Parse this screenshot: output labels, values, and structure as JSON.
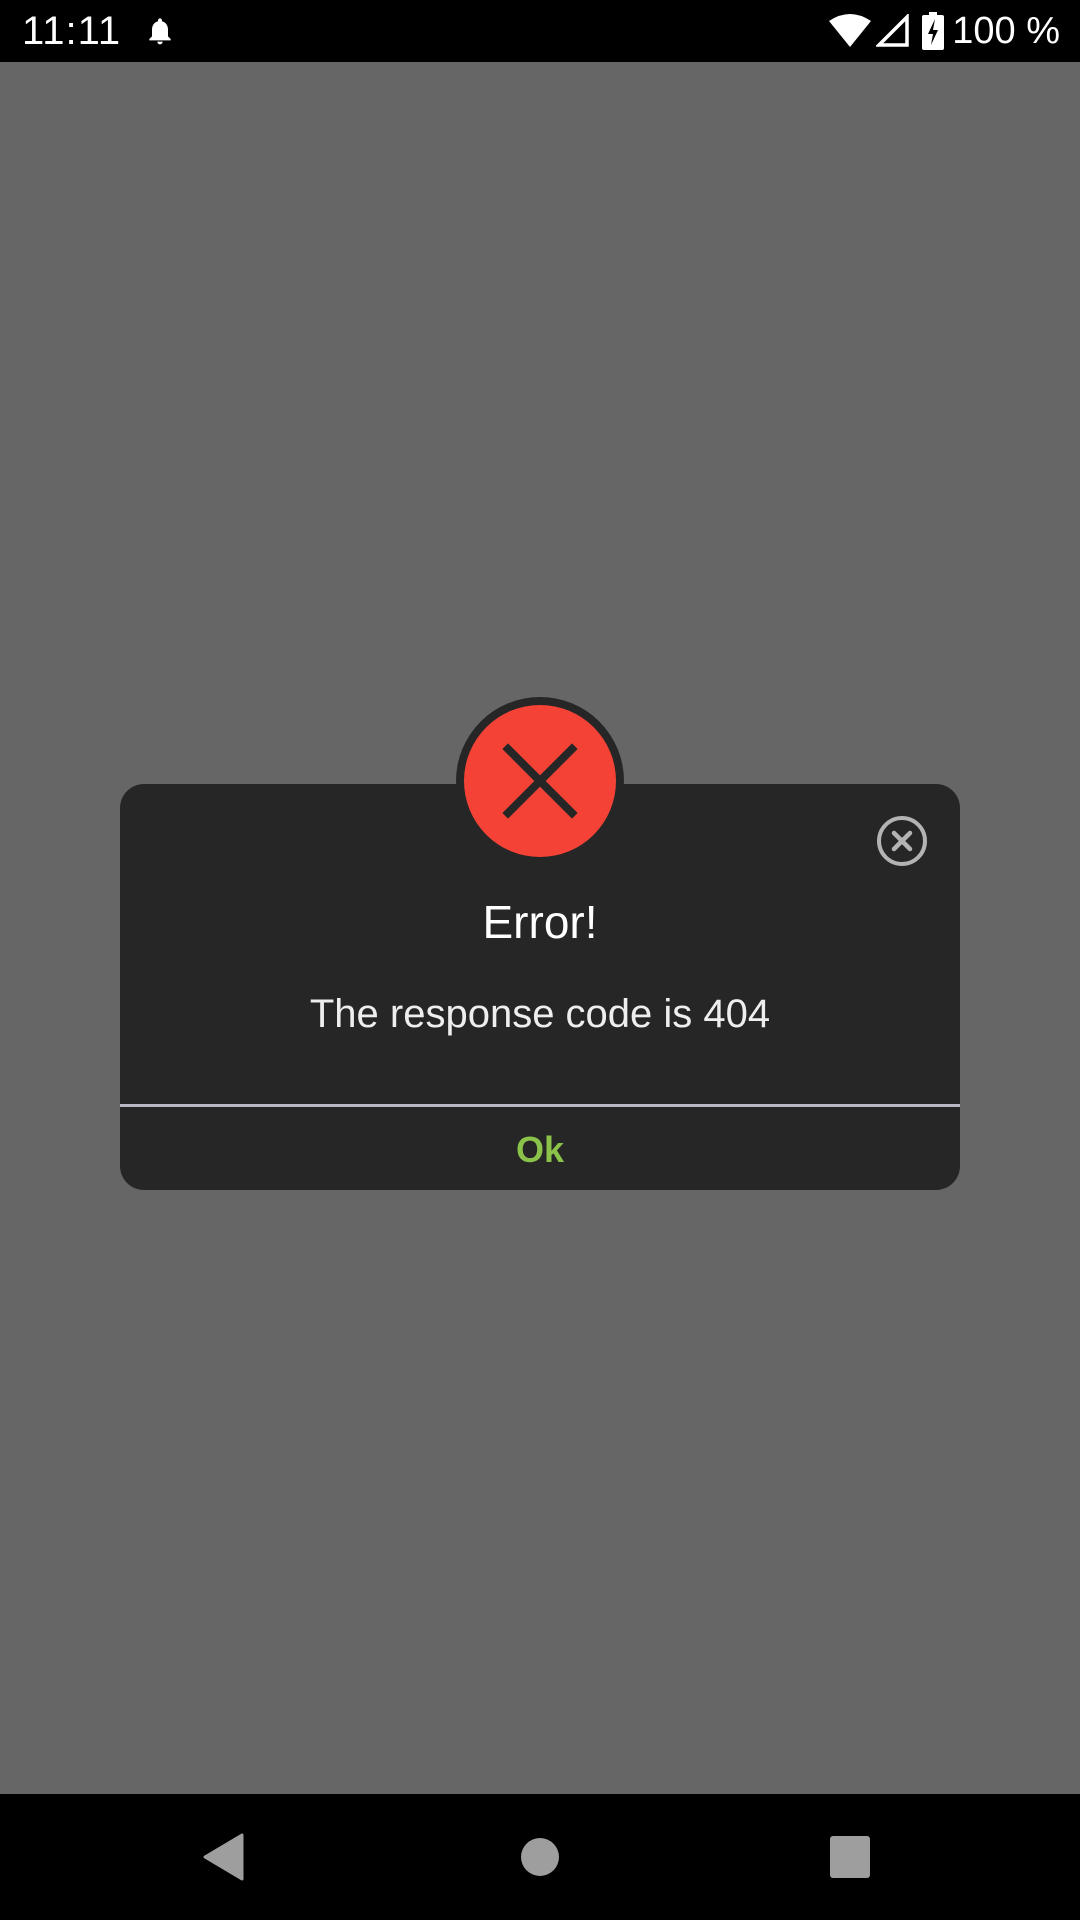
{
  "status_bar": {
    "time": "11:11",
    "battery_percent": "100 %",
    "icons": [
      "bell-icon",
      "wifi-icon",
      "signal-icon",
      "battery-charging-icon"
    ]
  },
  "dialog": {
    "title": "Error!",
    "message": "The response code is 404",
    "ok_label": "Ok",
    "icons": [
      "error-x-icon",
      "close-circle-icon"
    ]
  },
  "nav_bar": {
    "icons": [
      "back-icon",
      "home-icon",
      "recents-icon"
    ]
  },
  "colors": {
    "background_dim": "#666666",
    "dialog_bg": "#262626",
    "error_red": "#f44336",
    "ok_green": "#8bc34a",
    "divider": "#b9b9c3"
  }
}
